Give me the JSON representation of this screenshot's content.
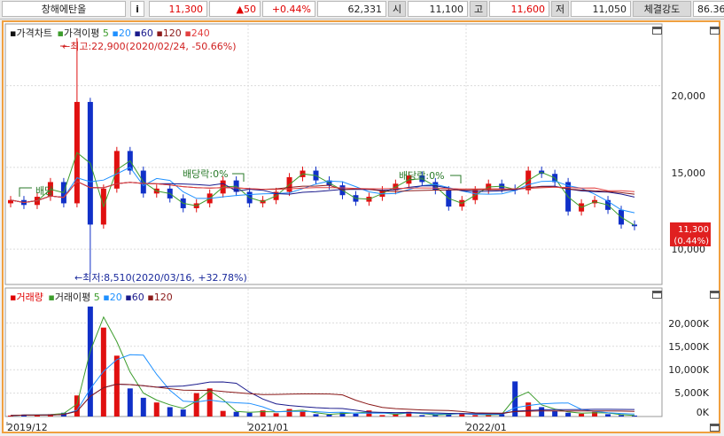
{
  "header": {
    "stock_name": "창해에탄올",
    "info_button": "i",
    "price": "11,300",
    "change": "▲50",
    "change_pct": "+0.44%",
    "volume": "62,331",
    "open_label": "시",
    "open": "11,100",
    "high_label": "고",
    "high": "11,600",
    "low_label": "저",
    "low": "11,050",
    "strength_label": "체결강도",
    "strength": "86.36"
  },
  "price_pane": {
    "title": "가격차트",
    "ma_label": "가격이평",
    "ma_periods": [
      "5",
      "20",
      "60",
      "120",
      "240"
    ],
    "ma_colors": [
      "#3c9c2c",
      "#1e90ff",
      "#1a1a8c",
      "#8b1a1a",
      "#e34040"
    ],
    "annotations": {
      "high": "←최고:22,900(2020/02/24, -50.66%)",
      "low": "←최저:8,510(2020/03/16, +32.78%)",
      "div1": "배당",
      "div2": "배당락:0%",
      "div3": "배당락:0%"
    },
    "current_price": "11,300",
    "current_pct": "(0.44%)"
  },
  "volume_pane": {
    "title": "거래량",
    "ma_label": "거래이평",
    "ma_periods": [
      "5",
      "20",
      "60",
      "120"
    ]
  },
  "x_axis": {
    "labels": [
      "2019/12",
      "2021/01",
      "2022/01"
    ]
  },
  "chart_data": [
    {
      "type": "candlestick",
      "title": "가격차트",
      "y_ticks": [
        "20,000",
        "15,000",
        "10,000"
      ],
      "ylim": [
        8000,
        23500
      ],
      "x_range": [
        "2019/12",
        "2022/09"
      ],
      "high": {
        "value": 22900,
        "date": "2020/02/24"
      },
      "low": {
        "value": 8510,
        "date": "2020/03/16"
      },
      "last": 11300,
      "close_approx": [
        13000,
        12700,
        13200,
        14100,
        12800,
        19000,
        11500,
        13700,
        16000,
        14800,
        13400,
        13700,
        13100,
        12500,
        12800,
        13400,
        14200,
        13500,
        12800,
        13000,
        13500,
        14400,
        14800,
        14200,
        13900,
        13300,
        12900,
        13200,
        13600,
        14000,
        14500,
        14100,
        13600,
        12600,
        13000,
        13600,
        14000,
        13700,
        13600,
        14800,
        14600,
        14100,
        12300,
        12800,
        13000,
        12400,
        11500,
        11400
      ]
    },
    {
      "type": "bar",
      "title": "거래량",
      "y_ticks": [
        "20,000K",
        "15,000K",
        "10,000K",
        "5,000K",
        "0K"
      ],
      "ylim": [
        0,
        25000
      ],
      "volume_approx_k": [
        200,
        400,
        300,
        500,
        800,
        4500,
        23500,
        19000,
        13000,
        6000,
        4000,
        3000,
        2000,
        1500,
        5000,
        6000,
        1200,
        1000,
        800,
        1300,
        700,
        1600,
        1100,
        500,
        400,
        900,
        600,
        1300,
        300,
        600,
        1000,
        300,
        400,
        500,
        700,
        300,
        400,
        500,
        7500,
        3000,
        2000,
        1200,
        800,
        600,
        1000,
        500,
        300,
        200
      ]
    }
  ]
}
